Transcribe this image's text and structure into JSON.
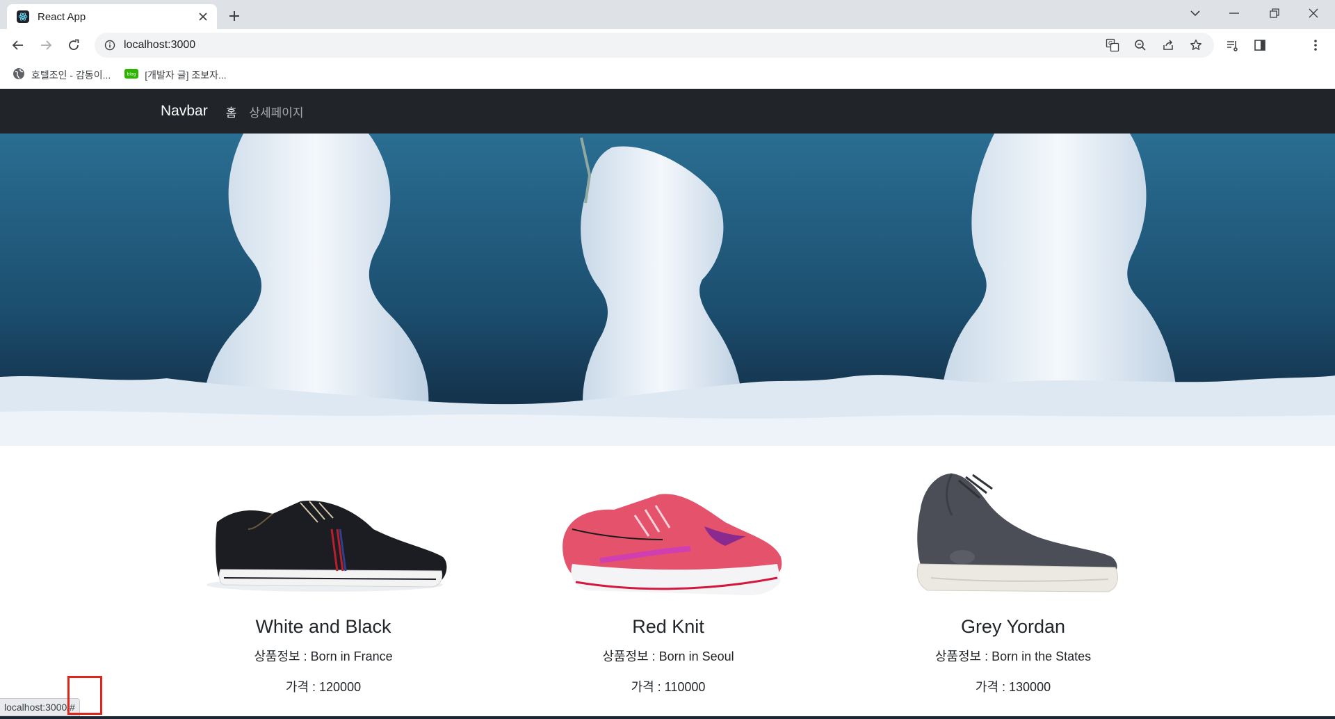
{
  "browser": {
    "tab_title": "React App",
    "url": "localhost:3000",
    "bookmarks": [
      {
        "label": "호텔조인 - 감동이..."
      },
      {
        "label": "[개발자 글] 조보자..."
      }
    ],
    "bookmark_badge": "blog"
  },
  "navbar": {
    "brand": "Navbar",
    "links": [
      {
        "label": "홈"
      },
      {
        "label": "상세페이지"
      }
    ]
  },
  "products": [
    {
      "title": "White and Black",
      "info": "상품정보 : Born in France",
      "price": "가격 : 120000"
    },
    {
      "title": "Red Knit",
      "info": "상품정보 : Born in Seoul",
      "price": "가격 : 110000"
    },
    {
      "title": "Grey Yordan",
      "info": "상품정보 : Born in the States",
      "price": "가격 : 130000"
    }
  ],
  "status_bar": {
    "url": "localhost:3000/#"
  },
  "colors": {
    "navbar_bg": "#212529",
    "hero_sky": "#1f5a7c",
    "snow": "#e6eef6",
    "highlight": "#e2231a"
  }
}
